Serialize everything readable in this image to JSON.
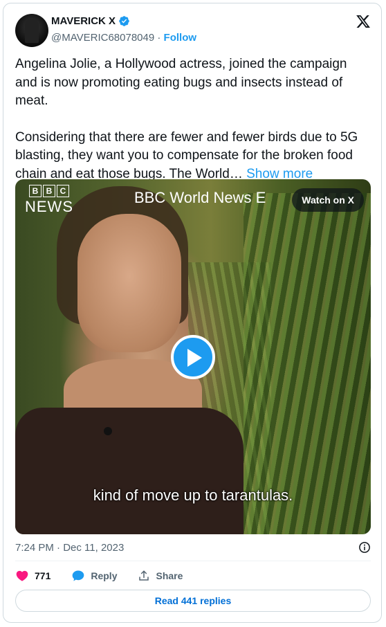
{
  "author": {
    "name": "MAVERICK X",
    "handle": "@MAVERIC68078049",
    "separator": "·",
    "follow_label": "Follow",
    "verified": true
  },
  "tweet": {
    "paragraph1": "Angelina Jolie, a Hollywood actress, joined the campaign and is now promoting eating bugs and insects instead of meat.",
    "paragraph2": "Considering that there are fewer and fewer birds due to 5G blasting, they want you to compensate for the broken food chain and eat those bugs. The World…",
    "show_more_label": "Show more"
  },
  "media": {
    "bbc_letters": [
      "B",
      "B",
      "C"
    ],
    "bbc_news": "NEWS",
    "ticker": "BBC World News E",
    "watch_label": "Watch on X",
    "subtitle": "kind of move up to tarantulas."
  },
  "meta": {
    "timestamp": "7:24 PM · Dec 11, 2023"
  },
  "actions": {
    "likes": "771",
    "reply_label": "Reply",
    "share_label": "Share",
    "read_replies_label": "Read 441 replies"
  },
  "colors": {
    "accent": "#1d9bf0",
    "like": "#f91880",
    "read_replies": "#006fd6",
    "secondary_text": "#536471"
  },
  "icons": [
    "verified-badge-icon",
    "x-logo-icon",
    "play-icon",
    "info-icon",
    "heart-icon",
    "reply-icon",
    "share-icon"
  ]
}
